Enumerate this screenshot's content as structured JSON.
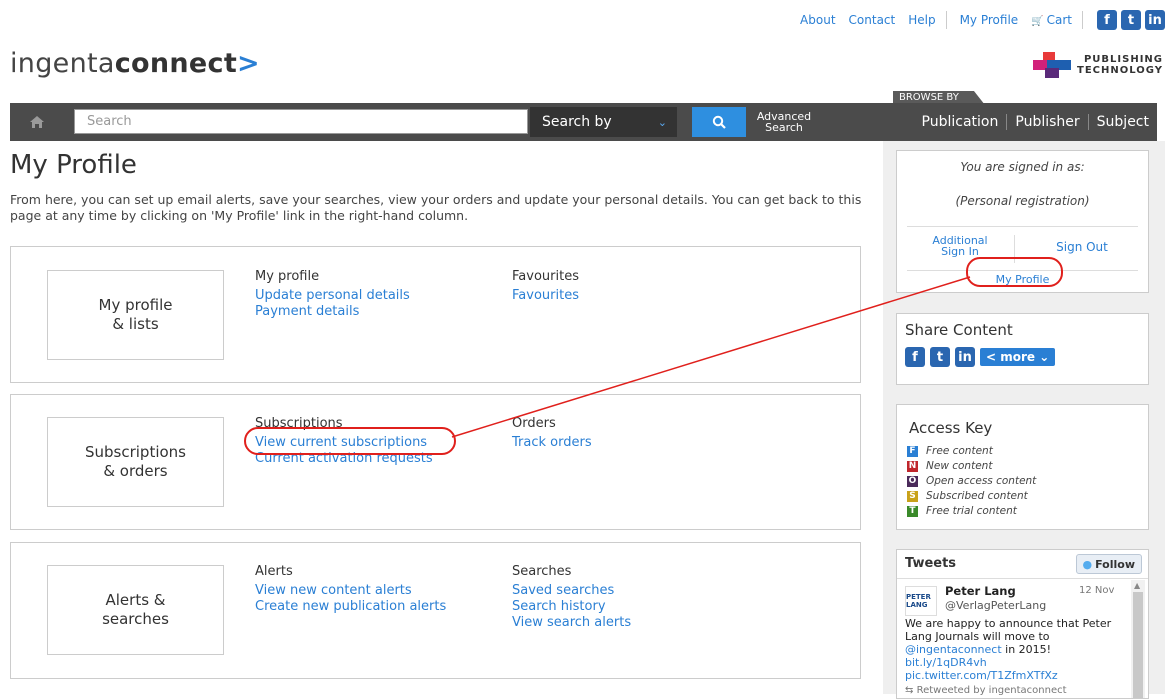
{
  "topnav": {
    "about": "About",
    "contact": "Contact",
    "help": "Help",
    "my_profile": "My Profile",
    "cart": "Cart",
    "social": [
      "f",
      "t",
      "in"
    ]
  },
  "logo": {
    "text_light": "ingenta",
    "text_bold": "connect",
    "chevron": ">",
    "partner_line1": "PUBLISHING",
    "partner_line2": "TECHNOLOGY"
  },
  "searchbar": {
    "placeholder": "Search",
    "search_by": "Search by",
    "search_icon": "search-icon",
    "advanced_line1": "Advanced",
    "advanced_line2": "Search",
    "browse_by": "BROWSE BY",
    "browse": [
      "Publication",
      "Publisher",
      "Subject"
    ]
  },
  "page": {
    "title": "My Profile",
    "intro": "From here, you can set up email alerts, save your searches, view your orders and update your personal details. You can get back to this page at any time by clicking on 'My Profile' link in the right-hand column."
  },
  "sections": [
    {
      "box_line1": "My profile",
      "box_line2": "& lists",
      "col1_heading": "My profile",
      "col1_links": [
        "Update personal details",
        "Payment details"
      ],
      "col2_heading": "Favourites",
      "col2_links": [
        "Favourites"
      ]
    },
    {
      "box_line1": "Subscriptions",
      "box_line2": "& orders",
      "col1_heading": "Subscriptions",
      "col1_links": [
        "View current subscriptions",
        "Current activation requests"
      ],
      "col2_heading": "Orders",
      "col2_links": [
        "Track orders"
      ]
    },
    {
      "box_line1": "Alerts &",
      "box_line2": "searches",
      "col1_heading": "Alerts",
      "col1_links": [
        "View new content alerts",
        "Create new publication alerts"
      ],
      "col2_heading": "Searches",
      "col2_links": [
        "Saved searches",
        "Search history",
        "View search alerts"
      ]
    }
  ],
  "sidebar": {
    "signed_in_as": "You are signed in as:",
    "registration": "(Personal registration)",
    "additional_line1": "Additional",
    "additional_line2": "Sign In",
    "sign_out": "Sign Out",
    "my_profile": "My Profile",
    "share_title": "Share Content",
    "share_more": "more",
    "access_key_title": "Access Key",
    "access_key": [
      {
        "letter": "F",
        "label": "Free content",
        "color": "#2a7fd4"
      },
      {
        "letter": "N",
        "label": "New content",
        "color": "#c0262c"
      },
      {
        "letter": "O",
        "label": "Open access content",
        "color": "#4a2a5a"
      },
      {
        "letter": "S",
        "label": "Subscribed content",
        "color": "#c9a21a"
      },
      {
        "letter": "T",
        "label": "Free trial content",
        "color": "#3a8a2a"
      }
    ]
  },
  "tweets": {
    "title": "Tweets",
    "follow": "Follow",
    "author": "Peter Lang",
    "handle": "@VerlagPeterLang",
    "date": "12 Nov",
    "avatar_text": "PETER LANG",
    "text": "We are happy to announce that Peter Lang Journals will move to",
    "mention": "@ingentaconnect",
    "text_tail": "in 2015!",
    "link1": "bit.ly/1qDR4vh",
    "link2": "pic.twitter.com/T1ZfmXTfXz",
    "retweet": "Retweeted by ingentaconnect"
  },
  "colors": {
    "link": "#2a7fd4",
    "bar": "#4b4b4b",
    "search_button": "#2e8fe0",
    "annotation": "#e0201c"
  }
}
